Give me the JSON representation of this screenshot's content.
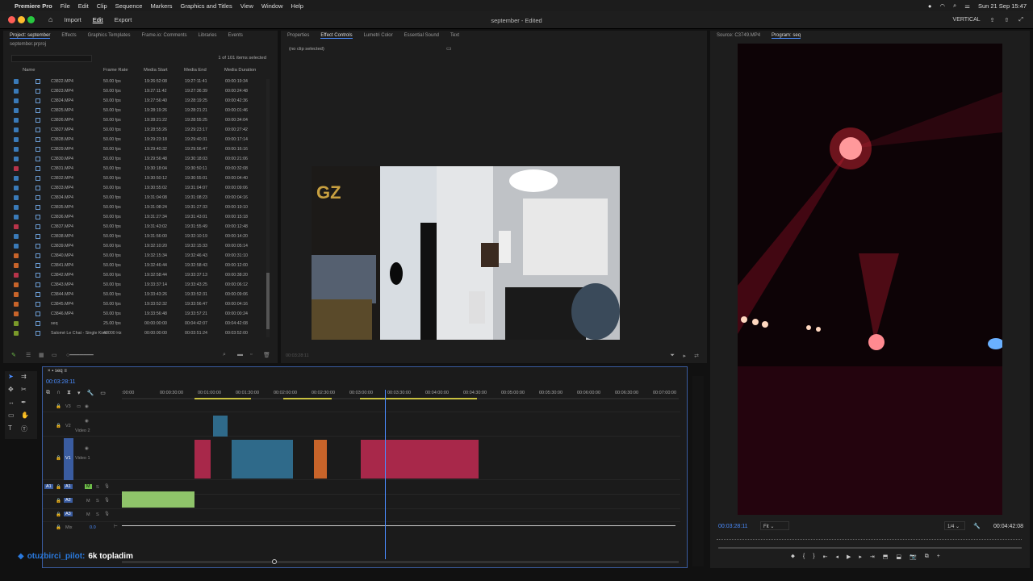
{
  "menubar": {
    "apple_icon": "apple-icon",
    "app": "Premiere Pro",
    "items": [
      "File",
      "Edit",
      "Clip",
      "Sequence",
      "Markers",
      "Graphics and Titles",
      "View",
      "Window",
      "Help"
    ],
    "clock": "Sun 21 Sep  15:47"
  },
  "titlebar": {
    "nav": [
      "Import",
      "Edit",
      "Export"
    ],
    "title": "september - Edited",
    "workspace": "VERTICAL"
  },
  "project": {
    "tabs": [
      "Project: september",
      "Effects",
      "Graphics Templates",
      "Frame.io: Comments",
      "Libraries",
      "Events"
    ],
    "path": "september.prproj",
    "count": "1 of 101 items selected",
    "columns": [
      "Name",
      "Frame Rate",
      "Media Start",
      "Media End",
      "Media Duration"
    ],
    "rows": [
      {
        "name": "C3822.MP4",
        "fps": "50.00 fps",
        "start": "19:26:52:08",
        "end": "19:27:11:41",
        "dur": "00:00:19:34",
        "color": "#3a7ab8"
      },
      {
        "name": "C3823.MP4",
        "fps": "50.00 fps",
        "start": "19:27:11:42",
        "end": "19:27:36:39",
        "dur": "00:00:24:48",
        "color": "#3a7ab8"
      },
      {
        "name": "C3824.MP4",
        "fps": "50.00 fps",
        "start": "19:27:56:40",
        "end": "19:28:19:25",
        "dur": "00:00:42:36",
        "color": "#3a7ab8"
      },
      {
        "name": "C3825.MP4",
        "fps": "50.00 fps",
        "start": "19:28:19:26",
        "end": "19:28:21:21",
        "dur": "00:00:01:46",
        "color": "#3a7ab8"
      },
      {
        "name": "C3826.MP4",
        "fps": "50.00 fps",
        "start": "19:28:21:22",
        "end": "19:28:55:25",
        "dur": "00:00:34:04",
        "color": "#3a7ab8"
      },
      {
        "name": "C3827.MP4",
        "fps": "50.00 fps",
        "start": "19:28:55:26",
        "end": "19:29:23:17",
        "dur": "00:00:27:42",
        "color": "#3a7ab8"
      },
      {
        "name": "C3828.MP4",
        "fps": "50.00 fps",
        "start": "19:29:23:18",
        "end": "19:29:40:31",
        "dur": "00:00:17:14",
        "color": "#3a7ab8"
      },
      {
        "name": "C3829.MP4",
        "fps": "50.00 fps",
        "start": "19:29:40:32",
        "end": "19:29:56:47",
        "dur": "00:00:16:16",
        "color": "#3a7ab8"
      },
      {
        "name": "C3830.MP4",
        "fps": "50.00 fps",
        "start": "19:29:56:48",
        "end": "19:30:18:03",
        "dur": "00:00:21:06",
        "color": "#3a7ab8"
      },
      {
        "name": "C3831.MP4",
        "fps": "50.00 fps",
        "start": "19:30:18:04",
        "end": "19:30:50:11",
        "dur": "00:00:32:08",
        "color": "#b8344a"
      },
      {
        "name": "C3832.MP4",
        "fps": "50.00 fps",
        "start": "19:30:50:12",
        "end": "19:30:55:01",
        "dur": "00:00:04:40",
        "color": "#3a7ab8"
      },
      {
        "name": "C3833.MP4",
        "fps": "50.00 fps",
        "start": "19:30:55:02",
        "end": "19:31:04:07",
        "dur": "00:00:09:06",
        "color": "#3a7ab8"
      },
      {
        "name": "C3834.MP4",
        "fps": "50.00 fps",
        "start": "19:31:04:08",
        "end": "19:31:08:23",
        "dur": "00:00:04:16",
        "color": "#3a7ab8"
      },
      {
        "name": "C3835.MP4",
        "fps": "50.00 fps",
        "start": "19:31:08:24",
        "end": "19:31:27:33",
        "dur": "00:00:19:10",
        "color": "#3a7ab8"
      },
      {
        "name": "C3836.MP4",
        "fps": "50.00 fps",
        "start": "19:31:27:34",
        "end": "19:31:43:01",
        "dur": "00:00:15:18",
        "color": "#3a7ab8"
      },
      {
        "name": "C3837.MP4",
        "fps": "50.00 fps",
        "start": "19:31:43:02",
        "end": "19:31:55:49",
        "dur": "00:00:12:48",
        "color": "#b8344a"
      },
      {
        "name": "C3838.MP4",
        "fps": "50.00 fps",
        "start": "19:31:56:00",
        "end": "19:32:10:19",
        "dur": "00:00:14:20",
        "color": "#3a7ab8"
      },
      {
        "name": "C3839.MP4",
        "fps": "50.00 fps",
        "start": "19:32:10:20",
        "end": "19:32:15:33",
        "dur": "00:00:05:14",
        "color": "#3a7ab8"
      },
      {
        "name": "C3840.MP4",
        "fps": "50.00 fps",
        "start": "19:32:15:34",
        "end": "19:32:46:43",
        "dur": "00:00:31:10",
        "color": "#c8642a"
      },
      {
        "name": "C3841.MP4",
        "fps": "50.00 fps",
        "start": "19:32:46:44",
        "end": "19:32:58:43",
        "dur": "00:00:12:00",
        "color": "#c8642a"
      },
      {
        "name": "C3842.MP4",
        "fps": "50.00 fps",
        "start": "19:32:58:44",
        "end": "19:33:37:13",
        "dur": "00:00:38:20",
        "color": "#b8344a"
      },
      {
        "name": "C3843.MP4",
        "fps": "50.00 fps",
        "start": "19:33:37:14",
        "end": "19:33:43:25",
        "dur": "00:00:06:12",
        "color": "#c8642a"
      },
      {
        "name": "C3844.MP4",
        "fps": "50.00 fps",
        "start": "19:33:43:26",
        "end": "19:33:52:31",
        "dur": "00:00:09:06",
        "color": "#c8642a"
      },
      {
        "name": "C3845.MP4",
        "fps": "50.00 fps",
        "start": "19:33:52:32",
        "end": "19:33:56:47",
        "dur": "00:00:04:16",
        "color": "#c8642a"
      },
      {
        "name": "C3846.MP4",
        "fps": "50.00 fps",
        "start": "19:33:56:48",
        "end": "19:33:57:21",
        "dur": "00:00:00:24",
        "color": "#c8642a"
      },
      {
        "name": "seq",
        "fps": "25.00 fps",
        "start": "00:00:00:00",
        "end": "00:04:42:07",
        "dur": "00:04:42:08",
        "color": "#7a9a2a"
      },
      {
        "name": "Salomé Le Chat - Single Kiss",
        "fps": "48000 Hz",
        "start": "00:00:00:00",
        "end": "00:03:51:24",
        "dur": "00:03:52:00",
        "color": "#7a9a2a"
      }
    ]
  },
  "effects": {
    "tabs": [
      "Properties",
      "Effect Controls",
      "Lumetri Color",
      "Essential Sound",
      "Text"
    ],
    "noclip": "(no clip selected)",
    "timecode": "00:03:28:11"
  },
  "timeline": {
    "seq": "seq",
    "playhead_tc": "00:03:28:11",
    "ruler": [
      ":00:00",
      "00:00:30:00",
      "00:01:00:00",
      "00:01:30:00",
      "00:02:00:00",
      "00:02:30:00",
      "00:03:00:00",
      "00:03:30:00",
      "00:04:00:00",
      "00:04:30:00",
      "00:05:00:00",
      "00:05:30:00",
      "00:06:00:00",
      "00:06:30:00",
      "00:07:00:00"
    ],
    "tracks": {
      "v3": "V3",
      "v2": "V2",
      "v2_name": "Video 2",
      "v1": "V1",
      "v1_name": "Video 1",
      "a1": "A1",
      "a2": "A2",
      "a3": "A3",
      "mix": "Mix",
      "mix_val": "0.0"
    }
  },
  "program": {
    "tabs": [
      "Source: C3749.MP4",
      "Program: seq"
    ],
    "timecode": "00:03:28:11",
    "fit": "Fit",
    "zoom": "1/4",
    "duration": "00:04:42:08"
  },
  "overlay": {
    "user": "otuzbirci_pilot:",
    "message": "6k topladim",
    "user_color": "#2a7adf"
  }
}
